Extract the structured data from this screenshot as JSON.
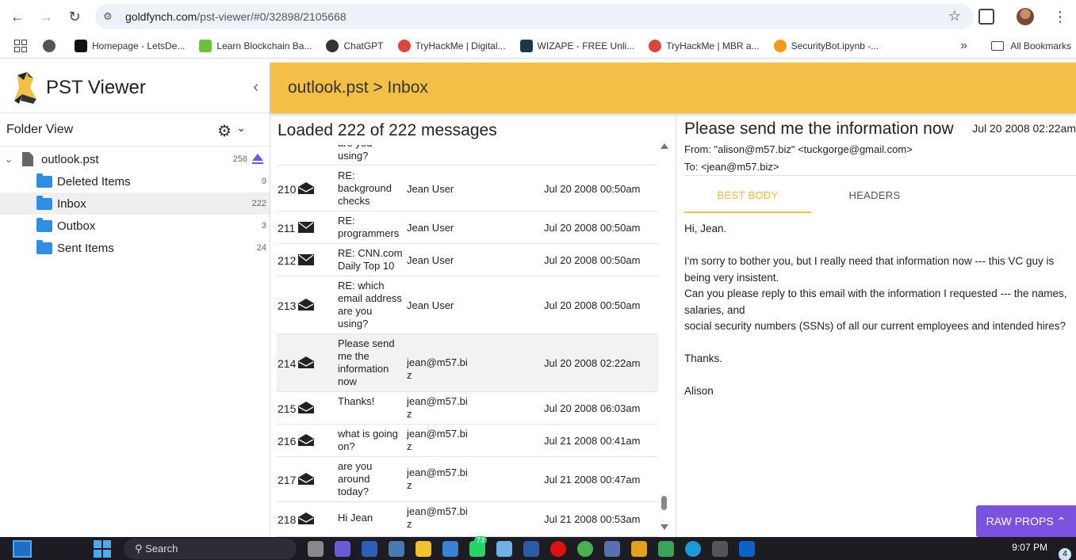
{
  "browser": {
    "url_host": "goldfynch.com",
    "url_path": "/pst-viewer/#0/32898/2105668",
    "bookmarks": [
      {
        "label": "Homepage - LetsDe...",
        "color": "#111"
      },
      {
        "label": "Learn Blockchain Ba...",
        "color": "#6bc13a"
      },
      {
        "label": "ChatGPT",
        "color": "#333"
      },
      {
        "label": "TryHackMe | Digital...",
        "color": "#d9463e"
      },
      {
        "label": "WIZAPE - FREE Unli...",
        "color": "#1a3a4a"
      },
      {
        "label": "TryHackMe | MBR a...",
        "color": "#d9463e"
      },
      {
        "label": "SecurityBot.ipynb -...",
        "color": "#f29b1a"
      }
    ],
    "all_bookmarks_label": "All Bookmarks"
  },
  "app": {
    "brand": "PST Viewer",
    "header_title": "outlook.pst > Inbox",
    "folder_view_label": "Folder View",
    "tree": {
      "root": {
        "label": "outlook.pst",
        "count": "258"
      },
      "folders": [
        {
          "label": "Deleted Items",
          "count": "9"
        },
        {
          "label": "Inbox",
          "count": "222"
        },
        {
          "label": "Outbox",
          "count": "3"
        },
        {
          "label": "Sent Items",
          "count": "24"
        }
      ]
    }
  },
  "list": {
    "title": "Loaded 222 of 222 messages",
    "partial_row": {
      "subject": "are you using?"
    },
    "rows": [
      {
        "num": "210",
        "subject": "RE: background checks",
        "from": "Jean User",
        "date": "Jul 20 2008 00:50am",
        "read": true
      },
      {
        "num": "211",
        "subject": "RE: programmers",
        "from": "Jean User",
        "date": "Jul 20 2008 00:50am",
        "read": false
      },
      {
        "num": "212",
        "subject": "RE: CNN.com Daily Top 10",
        "from": "Jean User",
        "date": "Jul 20 2008 00:50am",
        "read": false
      },
      {
        "num": "213",
        "subject": "RE: which email address are you using?",
        "from": "Jean User",
        "date": "Jul 20 2008 00:50am",
        "read": true
      },
      {
        "num": "214",
        "subject": "Please send me the information now",
        "from": "jean@m57.biz",
        "date": "Jul 20 2008 02:22am",
        "read": true
      },
      {
        "num": "215",
        "subject": "Thanks!",
        "from": "jean@m57.biz",
        "date": "Jul 20 2008 06:03am",
        "read": true
      },
      {
        "num": "216",
        "subject": "what is going on?",
        "from": "jean@m57.biz",
        "date": "Jul 21 2008 00:41am",
        "read": true
      },
      {
        "num": "217",
        "subject": "are you around today?",
        "from": "jean@m57.biz",
        "date": "Jul 21 2008 00:47am",
        "read": true
      },
      {
        "num": "218",
        "subject": "Hi Jean",
        "from": "jean@m57.biz",
        "date": "Jul 21 2008 00:53am",
        "read": true
      }
    ]
  },
  "detail": {
    "subject": "Please send me the information now",
    "date": "Jul 20 2008 02:22am",
    "from": "From: \"alison@m57.biz\" <tuckgorge@gmail.com>",
    "to": "To: <jean@m57.biz>",
    "tabs": [
      "BEST BODY",
      "HEADERS"
    ],
    "body": "Hi, Jean.\n\nI'm sorry to bother you, but I really need that information now --- this VC guy is being very insistent.\nCan you please reply to this email with the information I requested --- the names, salaries, and\nsocial security numbers (SSNs) of all our current employees and intended hires?\n\nThanks.\n\nAlison",
    "raw_props_label": "RAW PROPS"
  },
  "taskbar": {
    "search_label": "Search",
    "time": "9:07 PM",
    "badge": "4",
    "whatsapp_badge": "73"
  }
}
